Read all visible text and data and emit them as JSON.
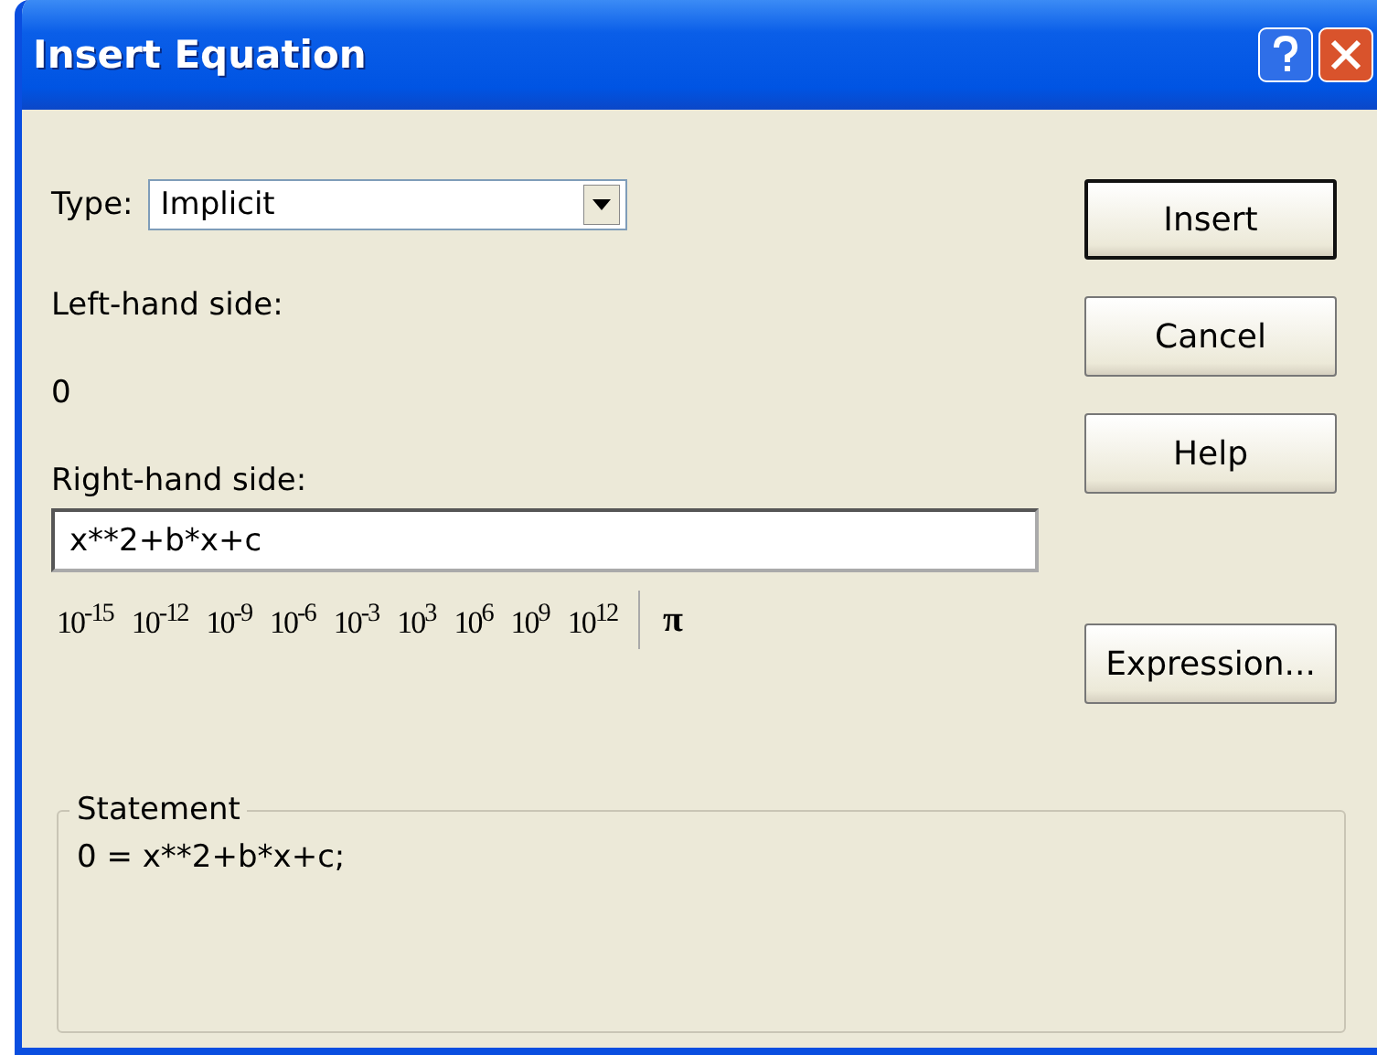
{
  "window": {
    "title": "Insert Equation"
  },
  "type_field": {
    "label": "Type:",
    "value": "Implicit"
  },
  "left_hand_side": {
    "label": "Left-hand side:",
    "value": "0"
  },
  "right_hand_side": {
    "label": "Right-hand side:",
    "value": "x**2+b*x+c"
  },
  "powers": [
    "10$^{-15}$",
    "10$^{-12}$",
    "10$^{-9}$",
    "10$^{-6}$",
    "10$^{-3}$",
    "10$^{3}$",
    "10$^{6}$",
    "10$^{9}$",
    "10$^{12}$"
  ],
  "symbol": "π",
  "buttons": [
    {
      "label": "Insert",
      "default": true
    },
    {
      "label": "Cancel",
      "default": false
    },
    {
      "label": "Help",
      "default": false
    }
  ],
  "expression_button": "Expression...",
  "statement": {
    "title": "Statement",
    "text": "0 = x**2+b*x+c;"
  }
}
